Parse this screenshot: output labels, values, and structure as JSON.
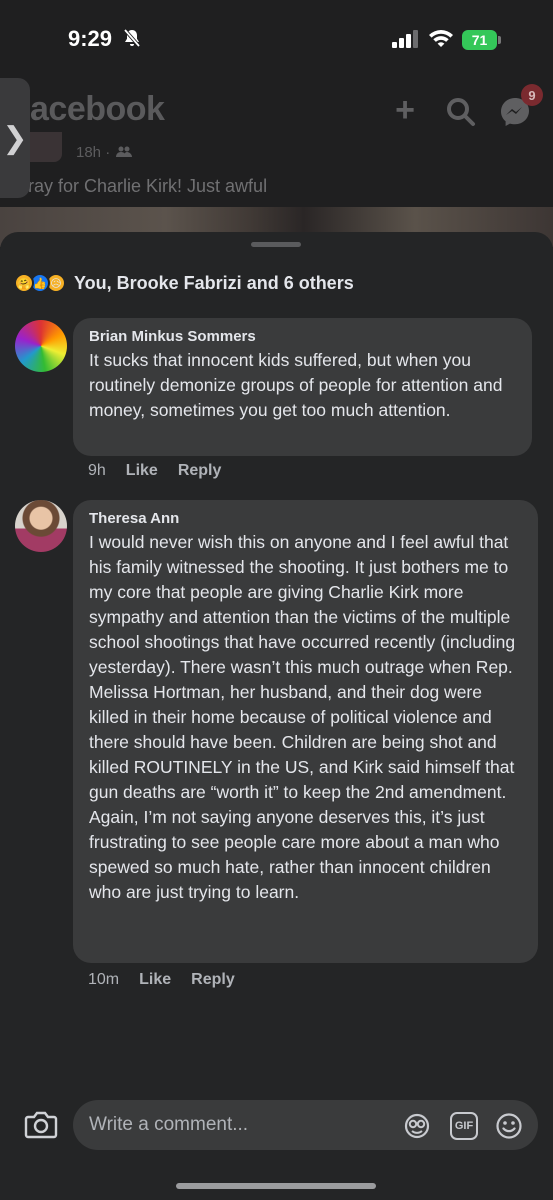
{
  "status": {
    "time": "9:29",
    "battery": "71"
  },
  "background": {
    "logo": "acebook",
    "messenger_badge": "9",
    "post_meta": "18h ·",
    "post_text": "ray for Charlie Kirk! Just awful"
  },
  "reactions": {
    "summary": "You, Brooke Fabrizi and 6 others"
  },
  "comments": [
    {
      "author": "Brian Minkus Sommers",
      "text": "It sucks that innocent kids suffered, but when you routinely demonize groups of people for attention and money, sometimes you get too much attention.",
      "time": "9h",
      "like": "Like",
      "reply": "Reply"
    },
    {
      "author": "Theresa Ann",
      "text": "I would never wish this on anyone and I feel awful that his family witnessed the shooting. It just bothers me to my core that people are giving Charlie Kirk more sympathy and attention than the victims of the multiple school shootings that have occurred recently (including yesterday). There wasn’t this much outrage when Rep. Melissa Hortman, her husband, and their dog were killed in their home because of political violence and there should have been. Children are being shot and killed ROUTINELY in the US, and Kirk said himself that gun deaths are “worth it” to keep the 2nd amendment. Again, I’m not saying anyone deserves this, it’s just frustrating to see people care more about a man who spewed so much hate, rather than innocent children who are just trying to learn.",
      "time": "10m",
      "like": "Like",
      "reply": "Reply"
    }
  ],
  "composer": {
    "placeholder": "Write a comment...",
    "gif_label": "GIF"
  },
  "colors": {
    "accent": "#1877f2",
    "battery": "#34c759",
    "sheet": "#242526",
    "bubble": "#3a3b3c"
  }
}
